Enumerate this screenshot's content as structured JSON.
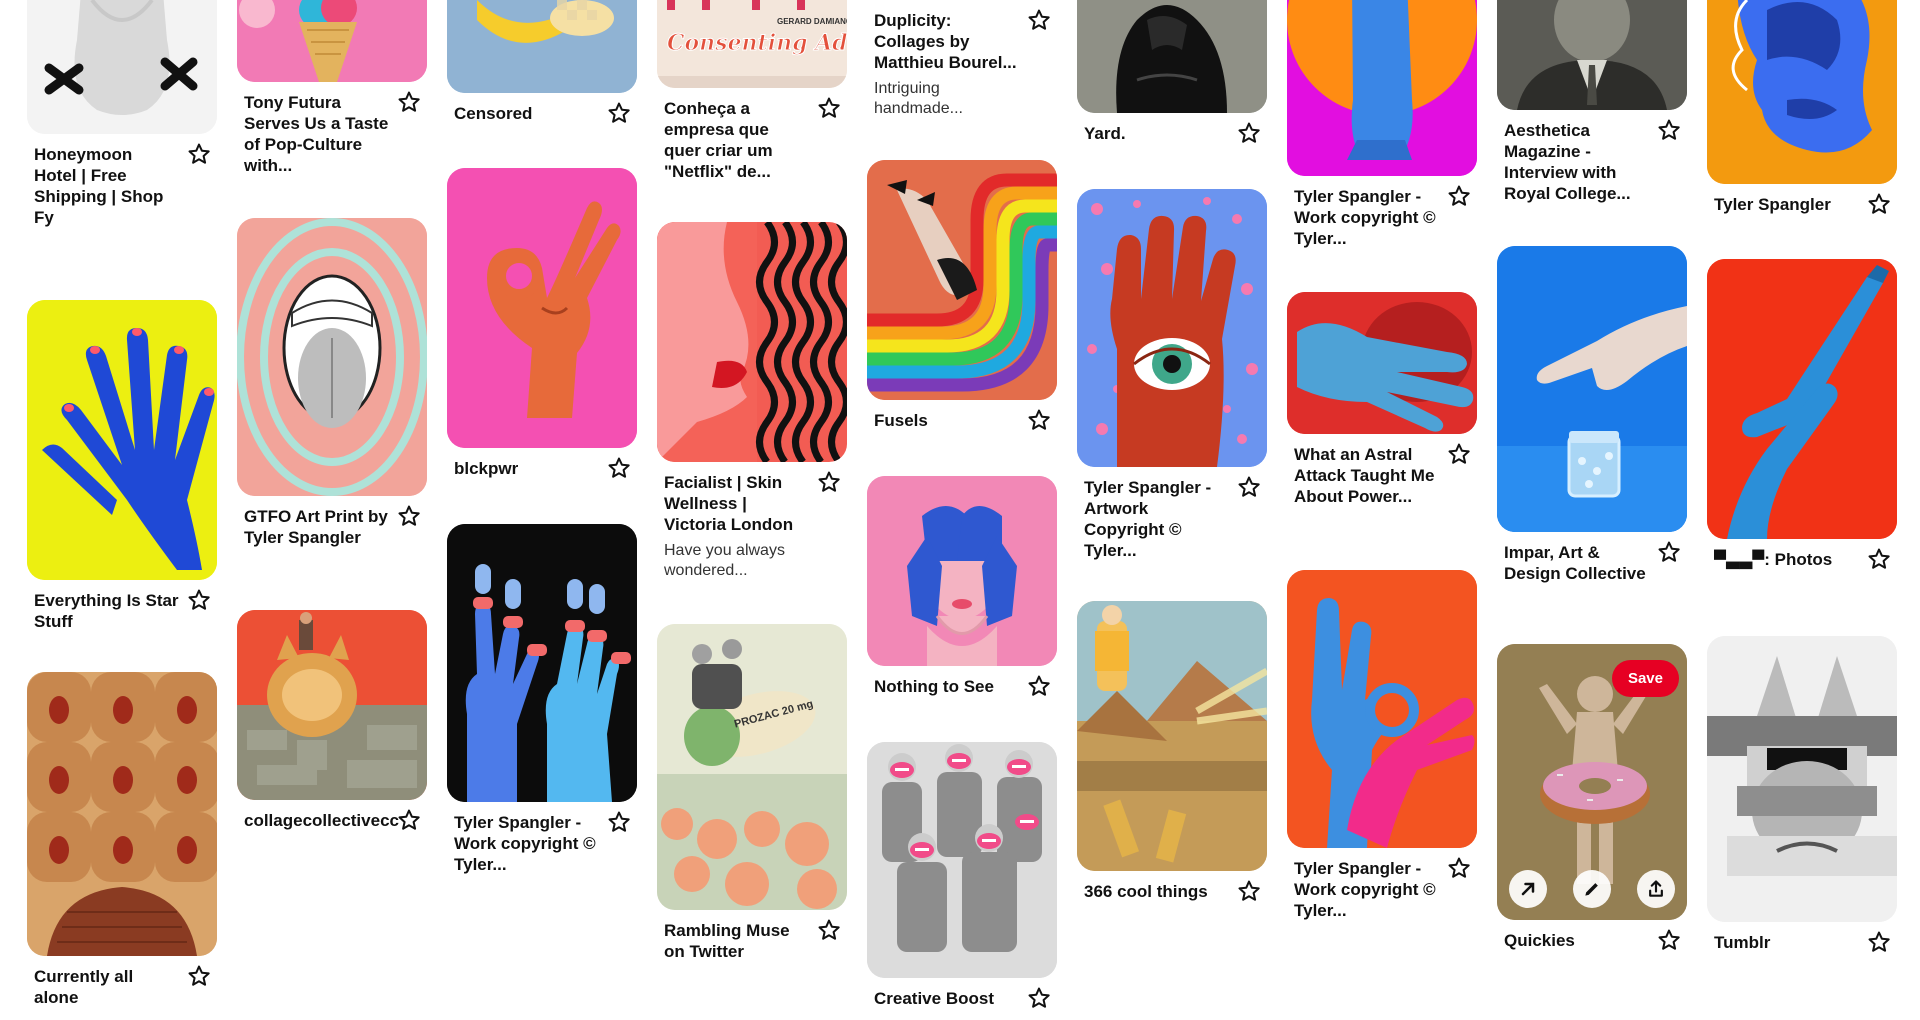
{
  "columns": [
    [
      {
        "title": "Honeymoon Hotel | Free Shipping | Shop Fy"
      },
      {
        "title": "Everything Is Star Stuff"
      },
      {
        "title": "Currently all alone"
      }
    ],
    [
      {
        "title": "Tony Futura Serves Us a Taste of Pop-Culture with..."
      },
      {
        "title": "GTFO Art Print by Tyler Spangler"
      },
      {
        "title": "collagecollectivecc"
      }
    ],
    [
      {
        "title": "Censored"
      },
      {
        "title": "blckpwr"
      },
      {
        "title": "Tyler Spangler - Work copyright © Tyler..."
      }
    ],
    [
      {
        "title": "Conheça a empresa que quer criar um \"Netflix\" de..."
      },
      {
        "title": "Facialist | Skin Wellness | Victoria London",
        "desc": "Have you always wondered..."
      },
      {
        "title": "Rambling Muse on Twitter"
      }
    ],
    [
      {
        "title": "Duplicity: Collages by Matthieu Bourel...",
        "desc": "Intriguing handmade..."
      },
      {
        "title": "Fusels"
      },
      {
        "title": "Nothing to See"
      },
      {
        "title": "Creative Boost"
      }
    ],
    [
      {
        "title": "Yard."
      },
      {
        "title": "Tyler Spangler - Artwork Copyright © Tyler..."
      },
      {
        "title": "366 cool things"
      }
    ],
    [
      {
        "title": "Tyler Spangler - Work copyright © Tyler..."
      },
      {
        "title": "What an Astral Attack Taught Me About Power..."
      },
      {
        "title": "Tyler Spangler - Work copyright © Tyler..."
      }
    ],
    [
      {
        "title": "Aesthetica Magazine - Interview with Royal College..."
      },
      {
        "title": "Impar, Art & Design Collective"
      },
      {
        "title": "Quickies",
        "save_label": "Save"
      }
    ],
    [
      {
        "title": "Tyler Spangler"
      },
      {
        "title": "▀▃▃▀: Photos"
      },
      {
        "title": "Tumblr"
      }
    ]
  ],
  "image_texts": {
    "consenting_header": "GERARD DAMIANO",
    "consenting_title": "Consenting Adults",
    "prozac_pill": "PROZAC 20 mg"
  },
  "icons": {
    "pin_action": "star-outline-icon",
    "hover_1": "arrow-up-right-icon",
    "hover_2": "pencil-icon",
    "hover_3": "share-icon"
  },
  "colors": {
    "save_red": "#e60023"
  }
}
